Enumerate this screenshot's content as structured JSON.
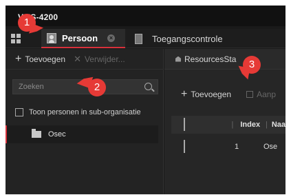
{
  "app": {
    "title": "VMS-4200"
  },
  "tabs": [
    {
      "label": "Persoon",
      "active": true
    },
    {
      "label": "Toegangscontrole",
      "active": false
    }
  ],
  "left_panel": {
    "add_label": "Toevoegen",
    "delete_label": "Verwijder...",
    "search_placeholder": "Zoeken",
    "show_sub_org_label": "Toon personen in sub-organisatie",
    "tree_items": [
      {
        "label": "Osec"
      }
    ]
  },
  "right_panel": {
    "section_title": "ResourcesSta",
    "add_label": "Toevoegen",
    "edit_label": "Aanp",
    "table": {
      "headers": [
        "Index",
        "Naa"
      ],
      "rows": [
        {
          "index": "1",
          "name": "Ose"
        }
      ]
    }
  },
  "markers": [
    "1",
    "2",
    "3"
  ],
  "colors": {
    "accent": "#d8303b",
    "marker": "#e63a36",
    "background": "#1a1a1a"
  }
}
